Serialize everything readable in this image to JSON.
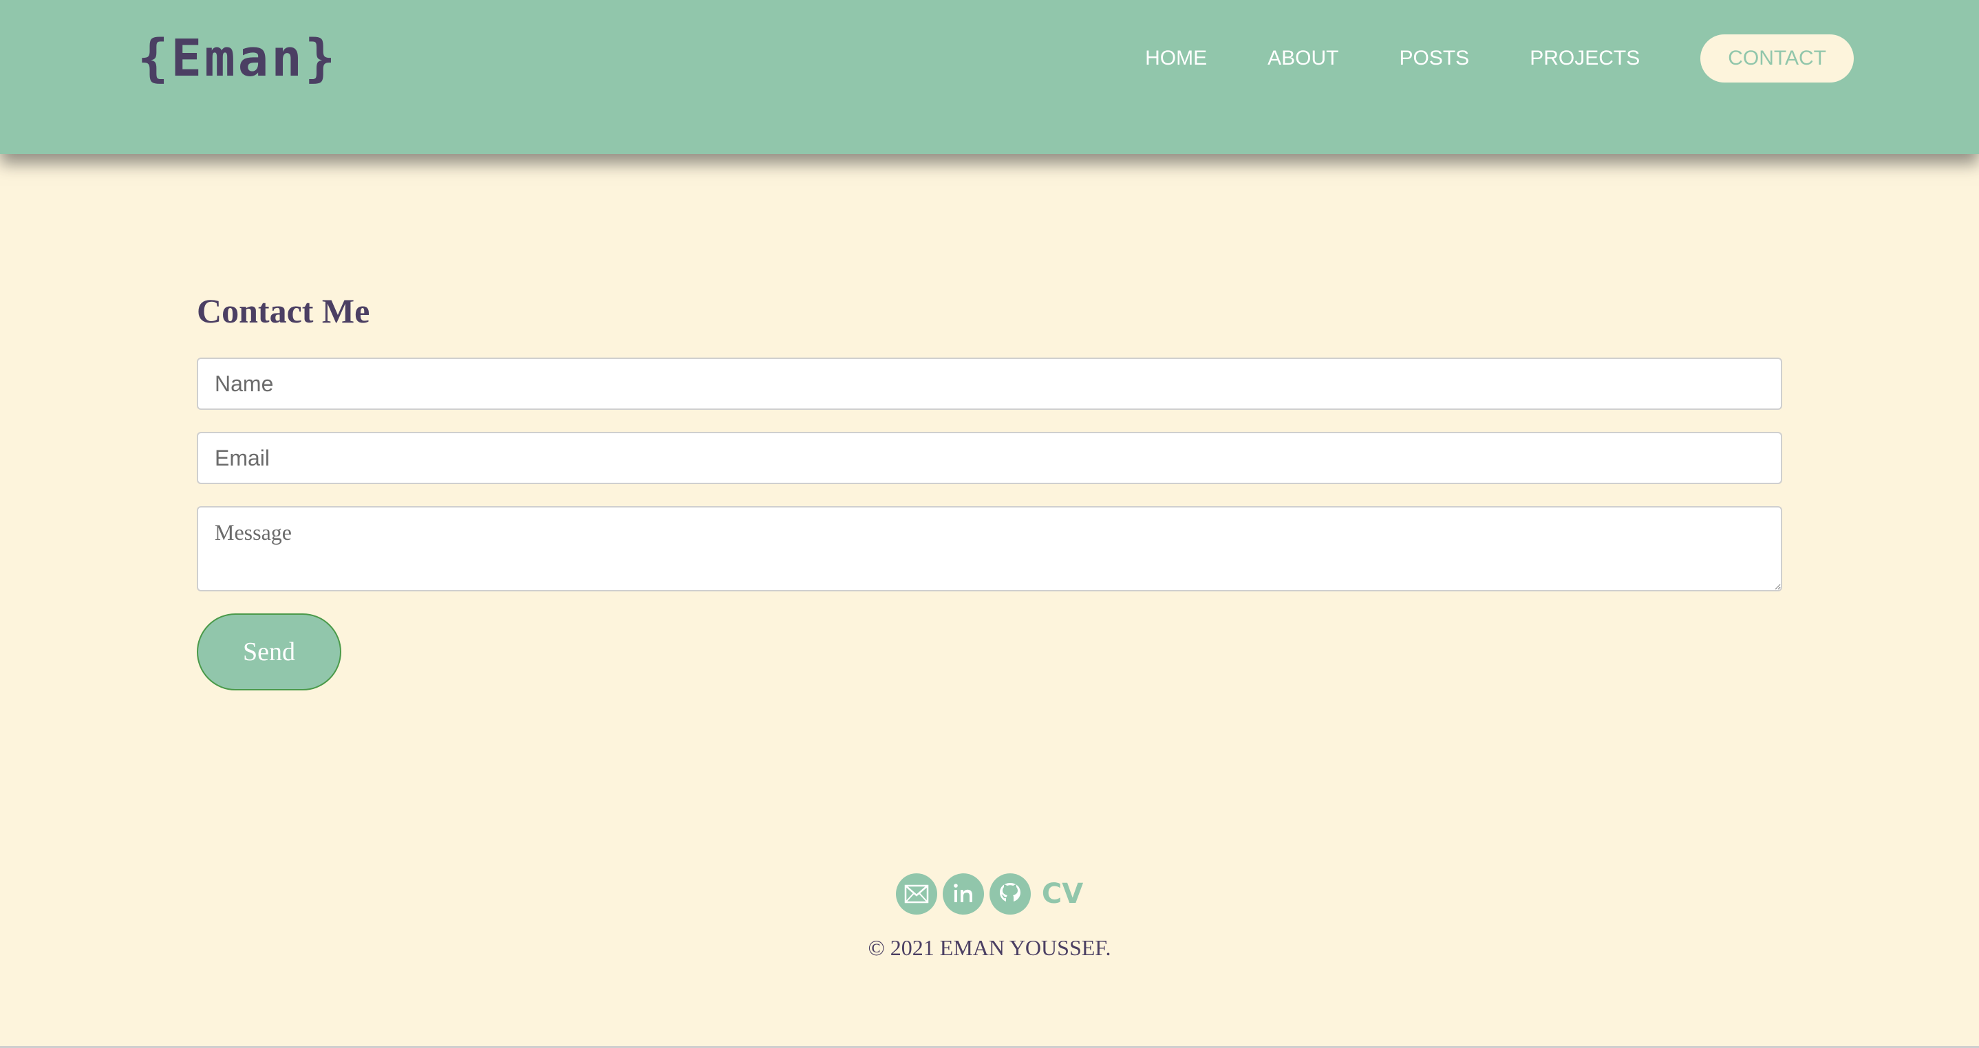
{
  "brand": {
    "logo_text": "{Eman}"
  },
  "nav": {
    "items": [
      {
        "label": "HOME"
      },
      {
        "label": "ABOUT"
      },
      {
        "label": "POSTS"
      },
      {
        "label": "PROJECTS"
      },
      {
        "label": "CONTACT",
        "active": true
      }
    ]
  },
  "contact": {
    "title": "Contact Me",
    "name_placeholder": "Name",
    "email_placeholder": "Email",
    "message_placeholder": "Message",
    "send_label": "Send"
  },
  "footer": {
    "social": [
      {
        "icon": "email-icon"
      },
      {
        "icon": "linkedin-icon"
      },
      {
        "icon": "github-icon"
      }
    ],
    "cv_label": "CV",
    "copyright": "© 2021 EMAN YOUSSEF."
  },
  "colors": {
    "header_bg": "#91c6ab",
    "page_bg": "#fdf4dc",
    "accent_text": "#4b3f63"
  }
}
